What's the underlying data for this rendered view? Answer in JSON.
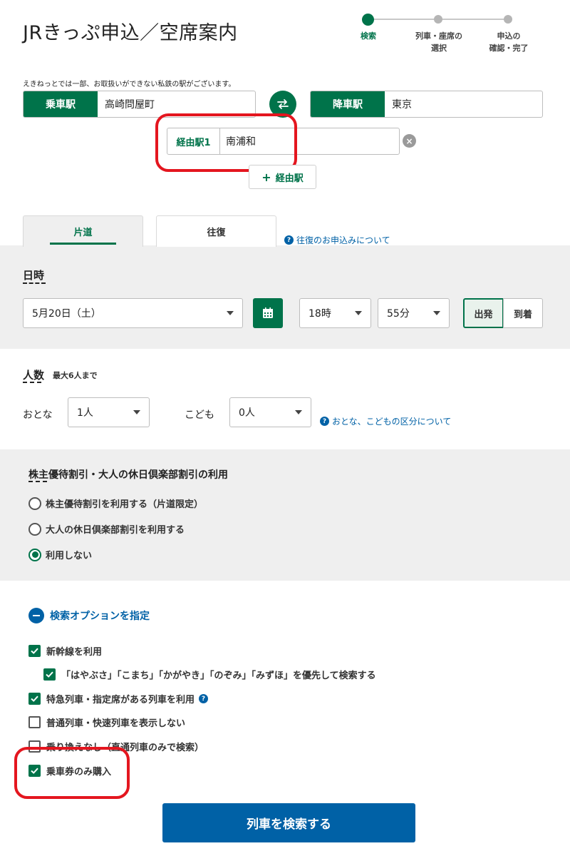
{
  "page_title": "JRきっぷ申込／空席案内",
  "stepper": [
    {
      "label": "検索",
      "active": true
    },
    {
      "label_line1": "列車・座席の",
      "label_line2": "選択",
      "active": false
    },
    {
      "label_line1": "申込の",
      "label_line2": "確認・完了",
      "active": false
    }
  ],
  "stepper_labels": {
    "step1": "検索",
    "step2a": "列車・座席の",
    "step2b": "選択",
    "step3a": "申込の",
    "step3b": "確認・完了"
  },
  "notice": "えきねっとでは一部、お取扱いができない私鉄の駅がございます。",
  "stations": {
    "from_label": "乗車駅",
    "from_value": "高崎問屋町",
    "to_label": "降車駅",
    "to_value": "東京",
    "swap_icon": "swap-arrows-icon",
    "via_label": "経由駅1",
    "via_value": "南浦和",
    "add_via_label": "経由駅"
  },
  "tabs": {
    "one_way": "片道",
    "round_trip": "往復",
    "round_trip_help": "往復のお申込みについて"
  },
  "datetime": {
    "title": "日時",
    "date": "5月20日（土）",
    "hour": "18時",
    "minute": "55分",
    "depart": "出発",
    "arrive": "到着",
    "selected": "出発"
  },
  "passengers": {
    "title": "人数",
    "note": "最大6人まで",
    "adult_label": "おとな",
    "adult_value": "1人",
    "child_label": "こども",
    "child_value": "0人",
    "help": "おとな、こどもの区分について"
  },
  "discount": {
    "title": "株主優待割引・大人の休日倶楽部割引の利用",
    "options": [
      {
        "label": "株主優待割引を利用する（片道限定）",
        "selected": false
      },
      {
        "label": "大人の休日倶楽部割引を利用する",
        "selected": false
      },
      {
        "label": "利用しない",
        "selected": true
      }
    ]
  },
  "search_options": {
    "toggle_label": "検索オプションを指定",
    "items": [
      {
        "label": "新幹線を利用",
        "checked": true
      },
      {
        "label": "「はやぶさ」「こまち」「かがやき」「のぞみ」「みずほ」を優先して検索する",
        "checked": true
      },
      {
        "label": "特急列車・指定席がある列車を利用",
        "checked": true
      },
      {
        "label": "普通列車・快速列車を表示しない",
        "checked": false
      },
      {
        "label": "乗り換えなし（直通列車のみで検索）",
        "checked": false
      },
      {
        "label": "乗車券のみ購入",
        "checked": true
      }
    ]
  },
  "search_button": "列車を検索する",
  "colors": {
    "primary_green": "#00734a",
    "link_blue": "#0061a6",
    "annotation_red": "#e4161f",
    "band_gray": "#efefef"
  }
}
